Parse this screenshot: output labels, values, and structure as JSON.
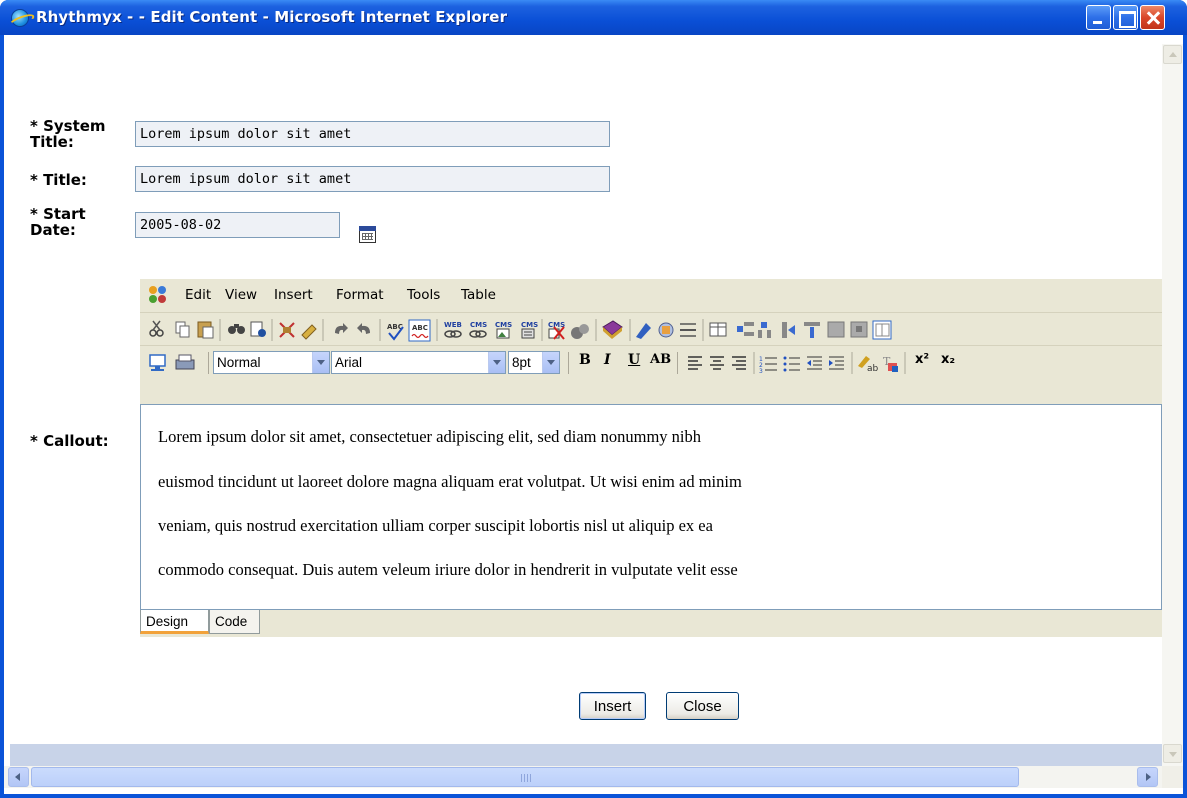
{
  "window": {
    "title": "Rhythmyx - - Edit Content - Microsoft Internet Explorer"
  },
  "form": {
    "system_title": {
      "label_line1": "* System",
      "label_line2": "Title:",
      "value": "Lorem ipsum dolor sit amet"
    },
    "title": {
      "label": "* Title:",
      "value": "Lorem ipsum dolor sit amet"
    },
    "start_date": {
      "label_line1": "* Start",
      "label_line2": "Date:",
      "value": "2005-08-02"
    },
    "callout": {
      "label": "* Callout:"
    }
  },
  "editor": {
    "menu": [
      "Edit",
      "View",
      "Insert",
      "Format",
      "Tools",
      "Table"
    ],
    "toolbar": {
      "style_select": "Normal",
      "font_select": "Arial",
      "size_select": "8pt",
      "bold": "B",
      "italic": "I",
      "underline": "U",
      "strikethrough": "AB",
      "superscript": "x²",
      "subscript": "x₂"
    },
    "content_lines": [
      "Lorem ipsum dolor sit amet, consectetuer adipiscing elit, sed diam nonummy nibh",
      "euismod tincidunt ut laoreet dolore magna aliquam erat volutpat. Ut wisi enim ad minim",
      "veniam, quis nostrud exercitation ulliam corper suscipit lobortis nisl ut aliquip ex ea",
      "commodo consequat. Duis autem veleum iriure dolor in hendrerit in vulputate velit esse"
    ],
    "tabs": {
      "design": "Design",
      "code": "Code"
    }
  },
  "buttons": {
    "insert": "Insert",
    "close": "Close"
  },
  "colors": {
    "titlebar": "#0a4fd6",
    "toolbar_bg": "#e9e7d5",
    "field_bg": "#eef1f6",
    "field_border": "#7f9db9"
  }
}
